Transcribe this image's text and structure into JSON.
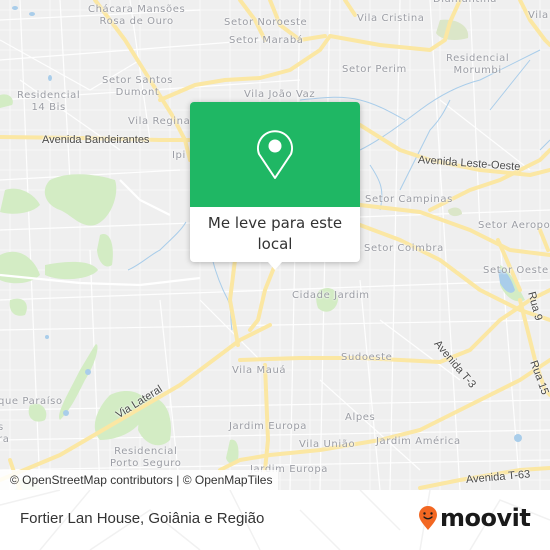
{
  "map": {
    "colors": {
      "background": "#efefef",
      "major_road": "#fbe7a3",
      "minor_road": "#ffffff",
      "park": "#d3ecc4",
      "water": "#a9cdea",
      "accent": "#1fb764"
    },
    "place_labels": [
      {
        "id": "chacara",
        "text": "Chácara Mansões\nRosa de Ouro"
      },
      {
        "id": "setor-noroeste",
        "text": "Setor Noroeste"
      },
      {
        "id": "setor-maraba",
        "text": "Setor Marabá"
      },
      {
        "id": "vila-cristina",
        "text": "Vila Cristina"
      },
      {
        "id": "diamantina",
        "text": "Diamantina"
      },
      {
        "id": "vila-ne",
        "text": "Vila"
      },
      {
        "id": "setor-perim",
        "text": "Setor Perim"
      },
      {
        "id": "residencial-morumbi",
        "text": "Residencial\nMorumbi"
      },
      {
        "id": "setor-santos-dumont",
        "text": "Setor Santos\nDumont"
      },
      {
        "id": "residencial-14-bis",
        "text": "Residencial\n14 Bis"
      },
      {
        "id": "vila-joao-vaz",
        "text": "Vila João Vaz"
      },
      {
        "id": "vila-regina",
        "text": "Vila Regina"
      },
      {
        "id": "ipiranga",
        "text": "Ipi"
      },
      {
        "id": "setor-campinas",
        "text": "Setor Campinas"
      },
      {
        "id": "setor-aeroporto",
        "text": "Setor Aeropo"
      },
      {
        "id": "setor-coimbra",
        "text": "Setor Coimbra"
      },
      {
        "id": "setor-oeste",
        "text": "Setor Oeste"
      },
      {
        "id": "cidade-jardim",
        "text": "Cidade Jardim"
      },
      {
        "id": "sudoeste",
        "text": "Sudoeste"
      },
      {
        "id": "vila-maua",
        "text": "Vila Mauá"
      },
      {
        "id": "parque-paraiso",
        "text": "que Paraíso"
      },
      {
        "id": "s-ra",
        "text": "s\nra"
      },
      {
        "id": "alpes",
        "text": "Alpes"
      },
      {
        "id": "jardim-europa",
        "text": "Jardim Europa"
      },
      {
        "id": "vila-uniao",
        "text": "Vila União"
      },
      {
        "id": "jardim-america",
        "text": "Jardim América"
      },
      {
        "id": "residencial-porto-seguro",
        "text": "Residencial\nPorto Seguro"
      },
      {
        "id": "jardim-europa-2",
        "text": "Jardim Europa"
      }
    ],
    "road_labels": [
      {
        "id": "avenida-bandeirantes",
        "text": "Avenida Bandeirantes"
      },
      {
        "id": "avenida-leste-oeste",
        "text": "Avenida Leste-Oeste"
      },
      {
        "id": "rua-9",
        "text": "Rua 9"
      },
      {
        "id": "avenida-t3",
        "text": "Avenida T-3"
      },
      {
        "id": "rua-15",
        "text": "Rua 15"
      },
      {
        "id": "via-lateral",
        "text": "Via Lateral"
      },
      {
        "id": "avenida-t63",
        "text": "Avenida T-63"
      }
    ],
    "attribution": "© OpenStreetMap contributors | © OpenMapTiles"
  },
  "popup": {
    "icon": "map-pin-icon",
    "label": "Me leve para este local"
  },
  "footer": {
    "title": "Fortier Lan House, Goiânia e Região",
    "brand": {
      "name": "moovit",
      "icon": "moovit-smiley-pin-icon",
      "icon_color": "#f26722"
    }
  }
}
